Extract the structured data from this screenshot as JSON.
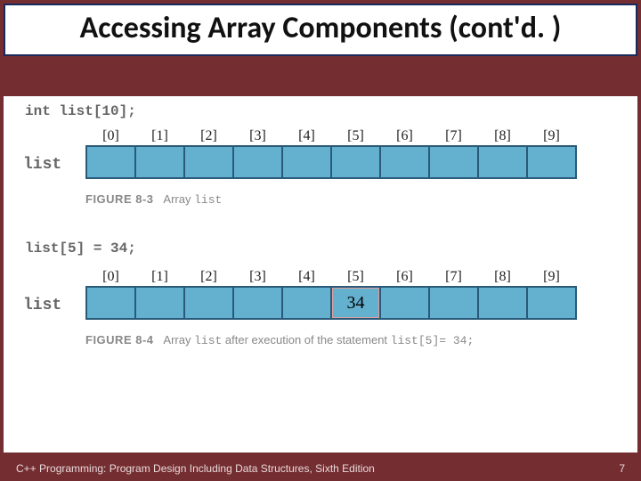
{
  "title": "Accessing Array Components (cont'd. )",
  "decl1": "int list[10];",
  "decl2": "list[5] = 34;",
  "array_label": "list",
  "indices": [
    "[0]",
    "[1]",
    "[2]",
    "[3]",
    "[4]",
    "[5]",
    "[6]",
    "[7]",
    "[8]",
    "[9]"
  ],
  "array1_values": [
    "",
    "",
    "",
    "",
    "",
    "",
    "",
    "",
    "",
    ""
  ],
  "array2_values": [
    "",
    "",
    "",
    "",
    "",
    "34",
    "",
    "",
    "",
    ""
  ],
  "fig1": {
    "num": "FIGURE 8-3",
    "text_pre": "Array ",
    "mono": "list",
    "text_post": ""
  },
  "fig2": {
    "num": "FIGURE 8-4",
    "text_pre": "Array ",
    "mono1": "list",
    "text_mid": " after execution of the statement ",
    "mono2": "list[5]= 34;"
  },
  "footer_text": "C++ Programming: Program Design Including Data Structures, Sixth Edition",
  "page_number": "7"
}
